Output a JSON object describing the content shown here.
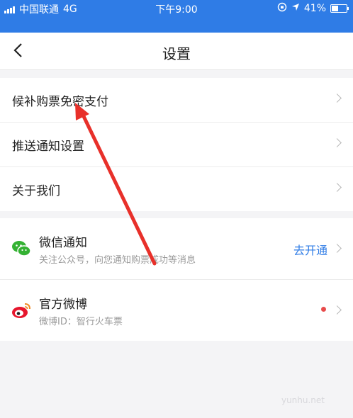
{
  "status_bar": {
    "carrier": "中国联通",
    "network": "4G",
    "time": "下午9:00",
    "battery": "41%",
    "battery_level": 0.41
  },
  "nav": {
    "title": "设置",
    "back_icon": "chevron-left-icon"
  },
  "settings_group": [
    {
      "label": "候补购票免密支付"
    },
    {
      "label": "推送通知设置"
    },
    {
      "label": "关于我们"
    }
  ],
  "social_group": {
    "wechat": {
      "title": "微信通知",
      "subtitle": "关注公众号，向您通知购票成功等消息",
      "action": "去开通",
      "icon": "wechat-icon",
      "icon_color": "#34b233"
    },
    "weibo": {
      "title": "官方微博",
      "subtitle": "微博ID：智行火车票",
      "icon": "weibo-icon",
      "icon_color": "#e6162d"
    }
  },
  "colors": {
    "accent": "#2f7ce6",
    "annotation": "#e8302a",
    "badge": "#e84b4b"
  },
  "watermark": "yunhu.net"
}
